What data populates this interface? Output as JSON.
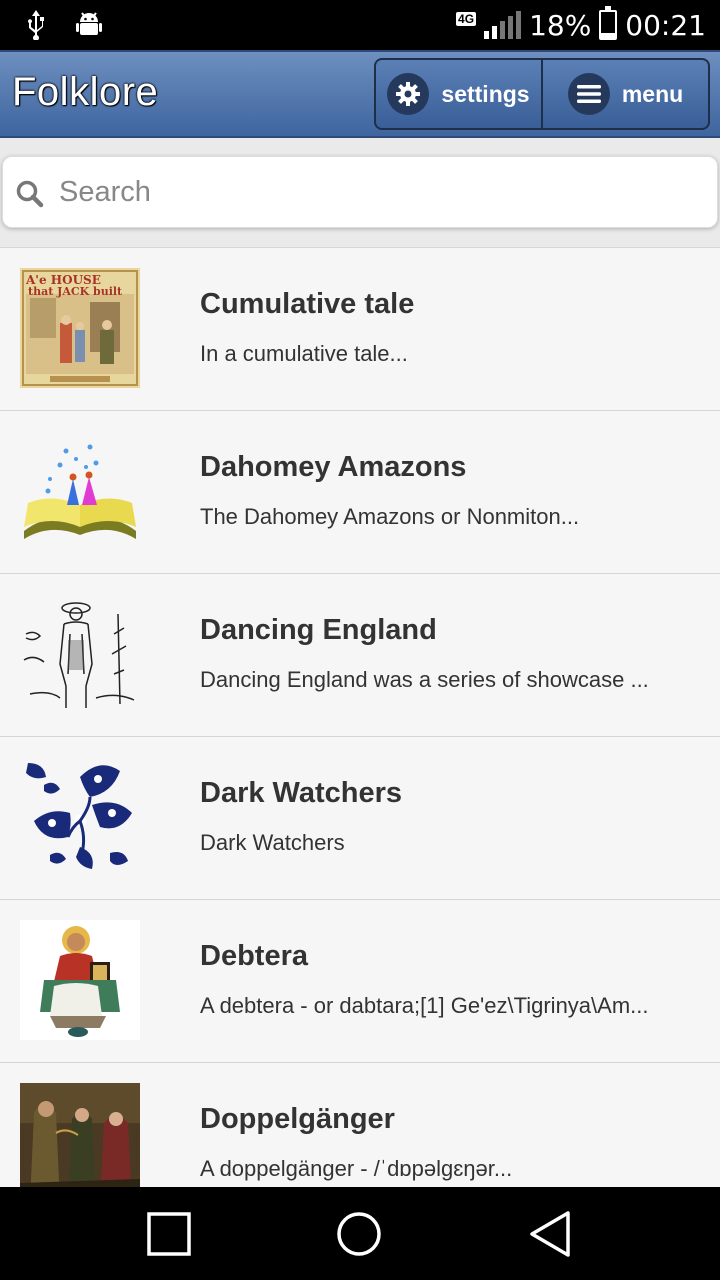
{
  "status_bar": {
    "network": "4G",
    "battery_level": 0.18,
    "battery": "18%",
    "time": "00:21",
    "left_icons": [
      "usb-icon",
      "android-icon"
    ]
  },
  "header": {
    "title": "Folklore",
    "settings_label": "settings",
    "menu_label": "menu"
  },
  "search": {
    "placeholder": "Search"
  },
  "entries": [
    {
      "title": "Cumulative tale",
      "desc": "In a cumulative tale...",
      "thumb": "house-that-jack-built-cover"
    },
    {
      "title": "Dahomey Amazons",
      "desc": "The Dahomey Amazons or Nonmiton...",
      "thumb": "open-book-with-figures"
    },
    {
      "title": "Dancing England",
      "desc": "Dancing England was a series of showcase ...",
      "thumb": "sketch-of-man"
    },
    {
      "title": "Dark Watchers",
      "desc": "Dark Watchers",
      "thumb": "blue-floral-ornament"
    },
    {
      "title": "Debtera",
      "desc": "A debtera - or dabtara;[1] Ge'ez\\Tigrinya\\Am...",
      "thumb": "icon-painting-figure"
    },
    {
      "title": "Doppelgänger",
      "desc": "A doppelgänger - /ˈdɒpəlɡɛŋər...",
      "thumb": "painting-couple"
    }
  ],
  "nav": [
    "recent-apps-button",
    "home-button",
    "back-button"
  ]
}
